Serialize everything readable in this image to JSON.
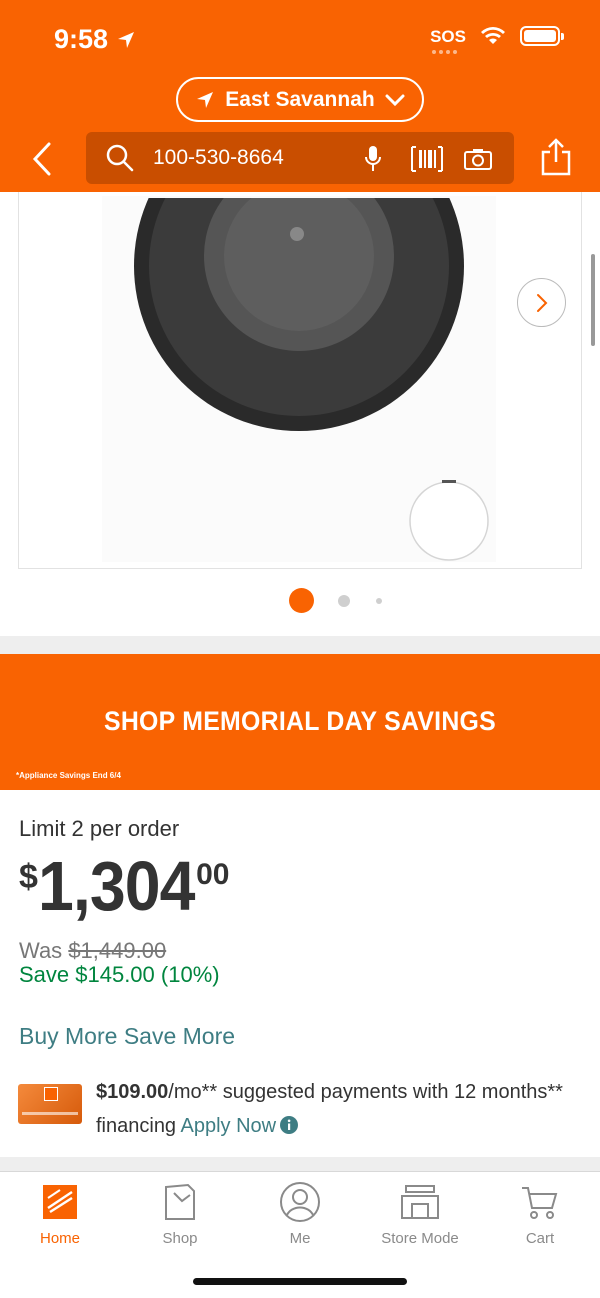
{
  "status_bar": {
    "time": "9:58",
    "sos": "SOS"
  },
  "header": {
    "store": "East Savannah",
    "search_value": "100-530-8664"
  },
  "gallery": {
    "image_count": 3,
    "active_index": 0
  },
  "banner": {
    "title": "SHOP MEMORIAL DAY SAVINGS",
    "note": "*Appliance Savings End 6/4"
  },
  "pricing": {
    "limit": "Limit 2 per order",
    "currency_symbol": "$",
    "price_main": "1,304",
    "price_cents": "00",
    "was_label": "Was",
    "was_amount": "$1,449.00",
    "save": "Save $145.00 (10%)",
    "promo_link": "Buy More Save More"
  },
  "financing": {
    "amount": "$109.00",
    "text_1": "/mo** suggested payments with 12 months** financing",
    "apply_label": "Apply Now"
  },
  "tabs": [
    {
      "label": "Home",
      "icon": "home-depot-logo-icon"
    },
    {
      "label": "Shop",
      "icon": "shop-bag-icon"
    },
    {
      "label": "Me",
      "icon": "user-icon"
    },
    {
      "label": "Store Mode",
      "icon": "store-icon"
    },
    {
      "label": "Cart",
      "icon": "cart-icon"
    }
  ],
  "colors": {
    "brand_orange": "#f96302",
    "search_bg": "#c94e00",
    "save_green": "#00853e",
    "link_teal": "#3e7d83"
  }
}
